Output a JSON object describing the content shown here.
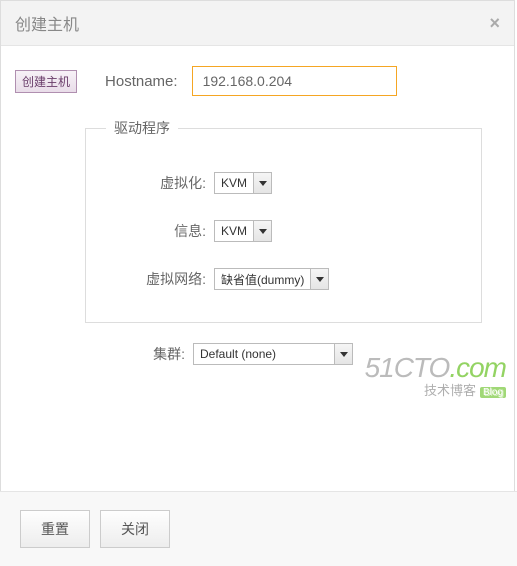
{
  "header": {
    "title": "创建主机"
  },
  "toolbar": {
    "create_button": "创建主机"
  },
  "hostname": {
    "label": "Hostname:",
    "value": "192.168.0.204"
  },
  "drivers": {
    "legend": "驱动程序",
    "virt": {
      "label": "虚拟化:",
      "value": "KVM"
    },
    "info": {
      "label": "信息:",
      "value": "KVM"
    },
    "vnet": {
      "label": "虚拟网络:",
      "value": "缺省值(dummy)"
    }
  },
  "cluster": {
    "label": "集群:",
    "value": "Default (none)"
  },
  "footer": {
    "reset": "重置",
    "close": "关闭"
  },
  "watermark": {
    "line1_a": "51CTO",
    "line1_b": ".com",
    "line2": "技术博客",
    "badge": "Blog"
  }
}
